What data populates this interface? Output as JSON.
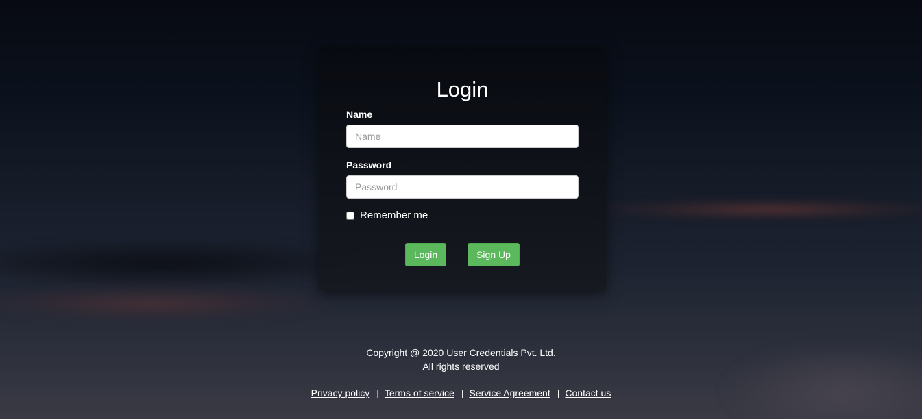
{
  "login_form": {
    "title": "Login",
    "name_label": "Name",
    "name_placeholder": "Name",
    "name_value": "",
    "password_label": "Password",
    "password_placeholder": "Password",
    "password_value": "",
    "remember_label": "Remember me",
    "remember_checked": false,
    "login_button": "Login",
    "signup_button": "Sign Up"
  },
  "footer": {
    "copyright": "Copyright @ 2020 User Credentials Pvt. Ltd.",
    "rights": "All rights reserved",
    "separator": "|",
    "links": [
      {
        "label": "Privacy policy"
      },
      {
        "label": "Terms of service"
      },
      {
        "label": "Service Agreement"
      },
      {
        "label": "Contact us"
      }
    ]
  },
  "colors": {
    "button_green": "#5cb85c",
    "card_background": "#0e1118",
    "text": "#ffffff"
  }
}
